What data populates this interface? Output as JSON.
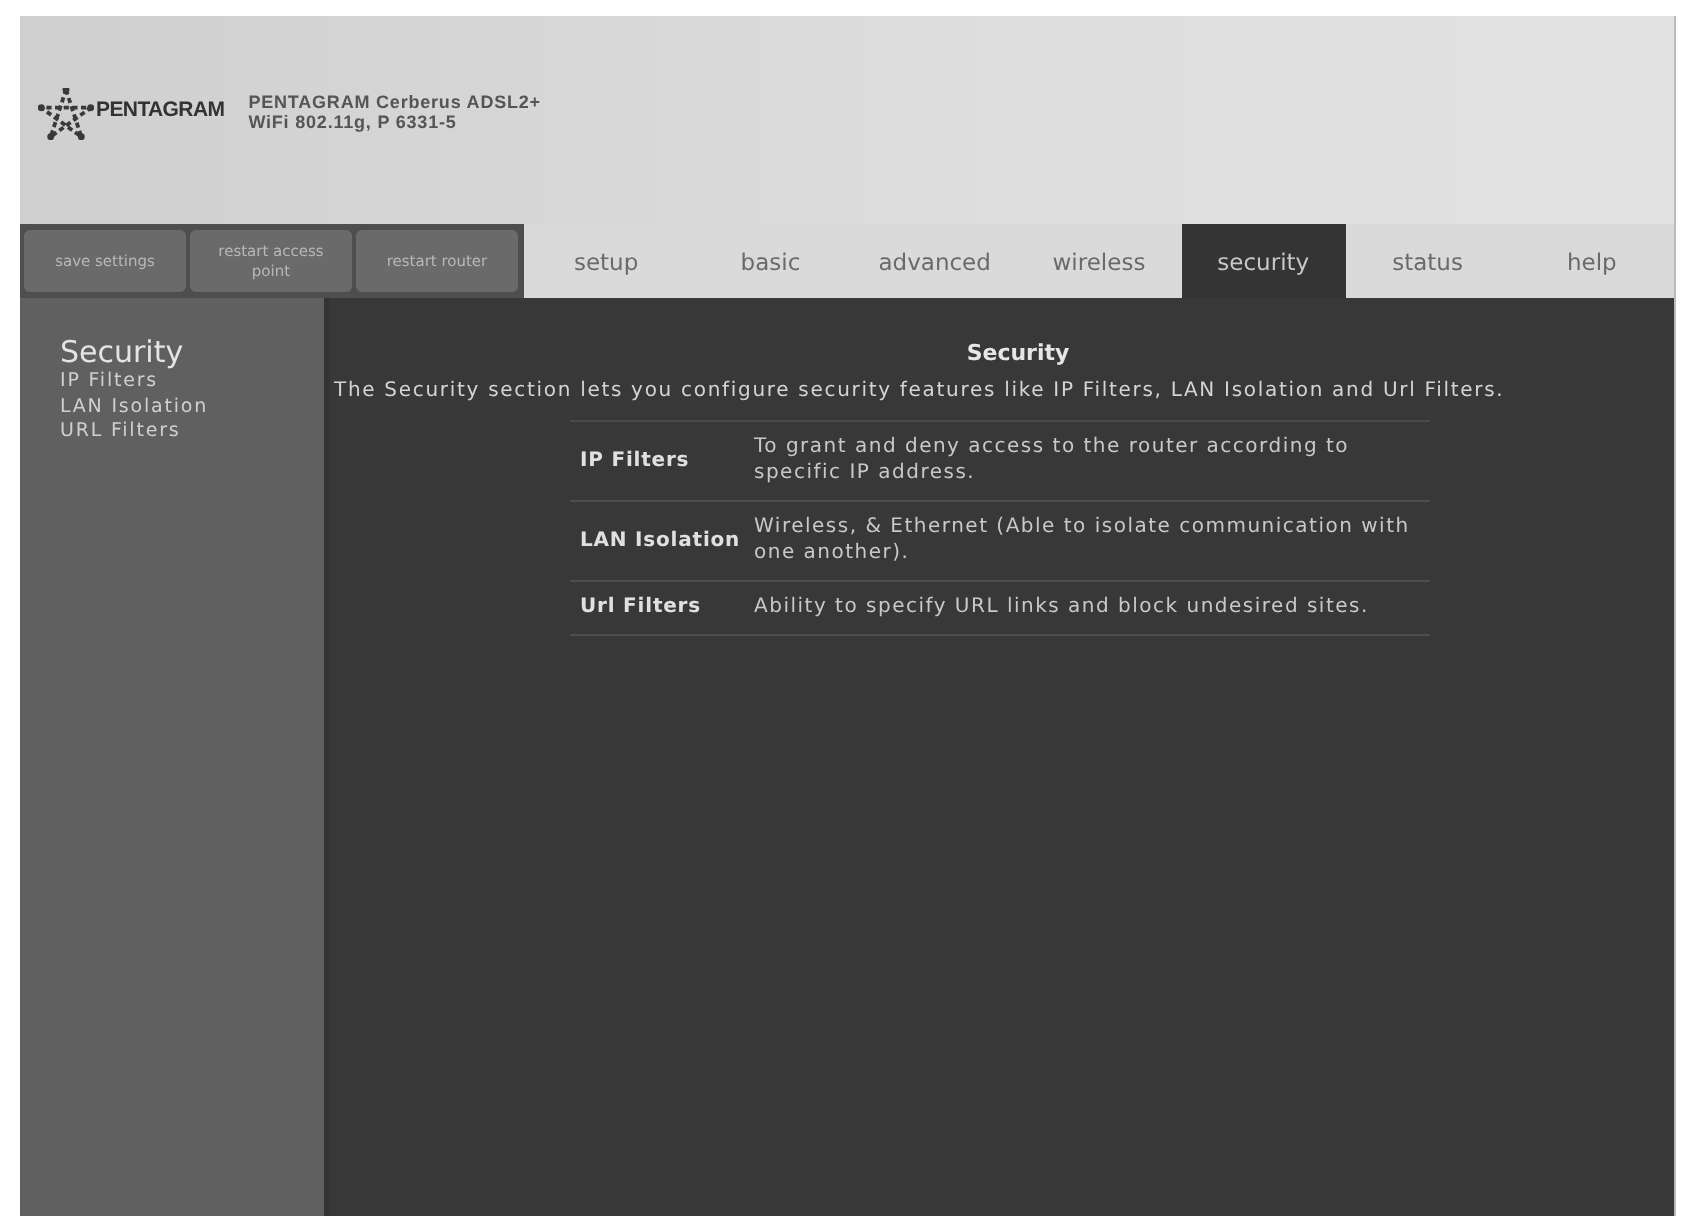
{
  "header": {
    "logo": "PENTAGRAM",
    "product_lines": [
      "PENTAGRAM Cerberus ADSL2+",
      "WiFi 802.11g, P 6331-5"
    ]
  },
  "action_buttons": [
    {
      "label": "save settings"
    },
    {
      "label": "restart access point"
    },
    {
      "label": "restart router"
    }
  ],
  "tabs": [
    {
      "label": "setup",
      "selected": false
    },
    {
      "label": "basic",
      "selected": false
    },
    {
      "label": "advanced",
      "selected": false
    },
    {
      "label": "wireless",
      "selected": false
    },
    {
      "label": "security",
      "selected": true
    },
    {
      "label": "status",
      "selected": false
    },
    {
      "label": "help",
      "selected": false
    }
  ],
  "sidebar": {
    "title": "Security",
    "items": [
      "IP Filters",
      "LAN Isolation",
      "URL Filters"
    ]
  },
  "content": {
    "title": "Security",
    "description": "The Security section lets you configure security features like IP Filters, LAN Isolation and Url Filters.",
    "features": [
      {
        "name": "IP Filters",
        "description": "To grant and deny access to the router according to specific IP address."
      },
      {
        "name": "LAN Isolation",
        "description": "Wireless, & Ethernet (Able to isolate communication with one another)."
      },
      {
        "name": "Url Filters",
        "description": "Ability to specify URL links and block undesired sites."
      }
    ]
  }
}
